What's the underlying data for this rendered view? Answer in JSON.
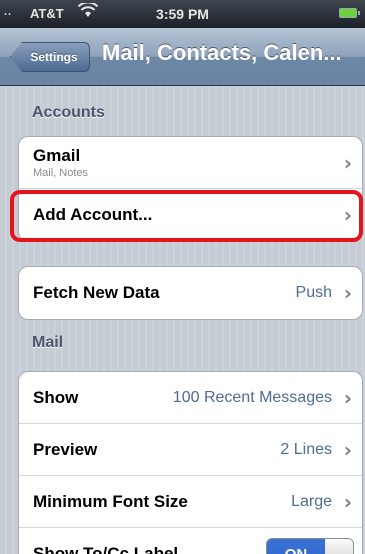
{
  "status_bar": {
    "signal": "..",
    "carrier": "AT&T",
    "time": "3:59 PM"
  },
  "nav": {
    "back_label": "Settings",
    "title": "Mail, Contacts, Calen..."
  },
  "sections": {
    "accounts": "Accounts",
    "mail": "Mail"
  },
  "accounts": [
    {
      "label": "Gmail",
      "sublabel": "Mail, Notes"
    },
    {
      "label": "Add Account..."
    }
  ],
  "fetch": {
    "label": "Fetch New Data",
    "value": "Push"
  },
  "mail_rows": [
    {
      "label": "Show",
      "value": "100 Recent Messages"
    },
    {
      "label": "Preview",
      "value": "2 Lines"
    },
    {
      "label": "Minimum Font Size",
      "value": "Large"
    },
    {
      "label": "Show To/Cc Label",
      "toggle": "ON"
    }
  ],
  "colors": {
    "highlight": "#e4141a",
    "value_text": "#4d6c93",
    "toggle_on": "#2d63c8"
  }
}
